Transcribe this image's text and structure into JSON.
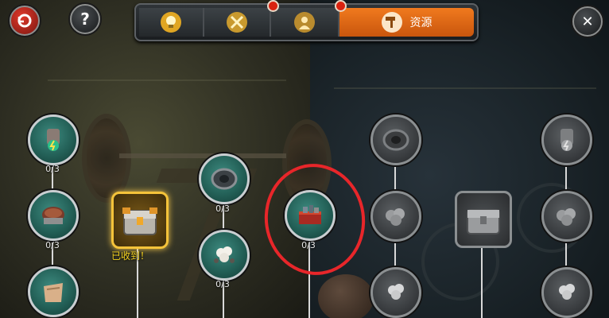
{
  "top_bar": {
    "help_label": "?",
    "close_label": "✕",
    "tabs": [
      {
        "icon": "lightbulb-icon",
        "label": "",
        "has_badge": false,
        "active": false
      },
      {
        "icon": "crossed-swords-icon",
        "label": "",
        "has_badge": true,
        "active": false
      },
      {
        "icon": "soldier-icon",
        "label": "",
        "has_badge": true,
        "active": false
      },
      {
        "icon": "hand-hammer-icon",
        "label": "资源",
        "has_badge": false,
        "active": true
      }
    ]
  },
  "tree": {
    "col1": [
      {
        "icon": "energy-generator-icon",
        "count": "0/3"
      },
      {
        "icon": "food-bowl-icon",
        "count": "0/3"
      },
      {
        "icon": "sack-icon",
        "count": ""
      }
    ],
    "col2": {
      "icon": "gold-chest-icon",
      "status": "已收到！"
    },
    "col3": [
      {
        "icon": "tire-icon",
        "count": "0/3"
      },
      {
        "icon": "cotton-icon",
        "count": "0/3"
      }
    ],
    "col4": {
      "icon": "red-toolbox-icon",
      "count": "0/3"
    },
    "col5": [
      {
        "icon": "tire-icon"
      },
      {
        "icon": "cotton-pile-icon"
      },
      {
        "icon": "cotton-icon"
      }
    ],
    "col6": {
      "icon": "gray-chest-icon"
    },
    "col7": [
      {
        "icon": "energy-generator-icon"
      },
      {
        "icon": "cotton-pile-icon"
      },
      {
        "icon": "cotton-icon"
      }
    ]
  }
}
